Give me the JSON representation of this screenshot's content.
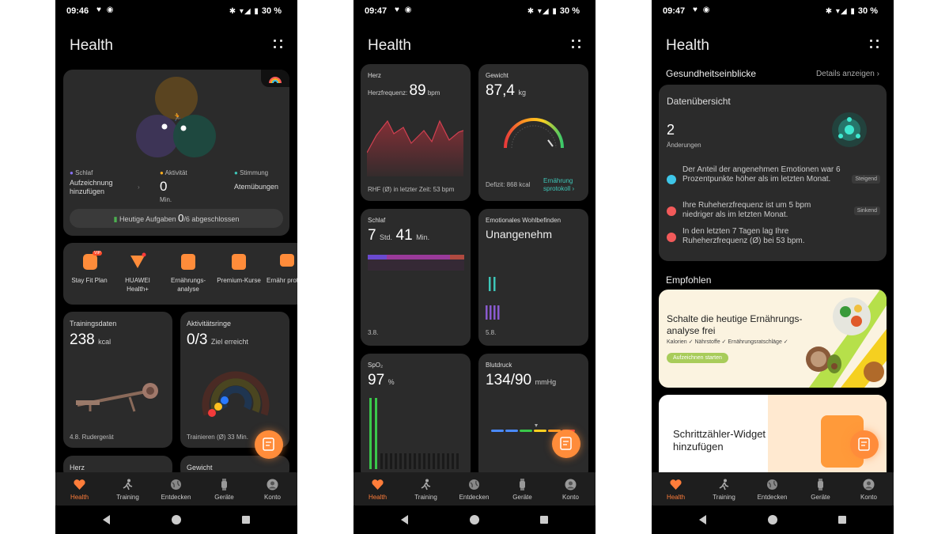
{
  "status": [
    {
      "time": "09:46",
      "icons": "♥ ◉",
      "right_icons": "✱ ▾◢ ▮",
      "battery": "30 %"
    },
    {
      "time": "09:47",
      "icons": "♥ ◉",
      "right_icons": "✱ ▾◢ ▮",
      "battery": "30 %"
    },
    {
      "time": "09:47",
      "icons": "♥ ◉",
      "right_icons": "✱ ▾◢ ▮",
      "battery": "30 %"
    }
  ],
  "app_title": "Health",
  "tabs": [
    "Health",
    "Training",
    "Entdecken",
    "Geräte",
    "Konto"
  ],
  "screen1": {
    "rings": {
      "schlaf_label": "Schlaf",
      "schlaf_value": "Aufzeichnung hinzufügen",
      "aktivitaet_label": "Aktivität",
      "aktivitaet_value": "0",
      "aktivitaet_unit": "Min.",
      "stimmung_label": "Stimmung",
      "stimmung_value": "Atemübungen",
      "tasks_prefix": "Heutige Aufgaben ",
      "tasks_count": "0",
      "tasks_suffix": "/6 abgeschlossen"
    },
    "shortcuts": [
      {
        "label": "Stay Fit Plan",
        "badge": "VIP"
      },
      {
        "label": "HUAWEI Health+"
      },
      {
        "label": "Ernährungs-analyse"
      },
      {
        "label": "Premium-Kurse"
      },
      {
        "label": "Ernähr protc"
      }
    ],
    "training": {
      "title": "Trainingsdaten",
      "value": "238",
      "unit": "kcal",
      "footer": "4.8. Rudergerät"
    },
    "rings_card": {
      "title": "Aktivitätsringe",
      "value": "0/3",
      "subtitle": "Ziel erreicht",
      "footer": "Trainieren (Ø) 33 Min."
    },
    "peek_left": "Herz",
    "peek_right": "Gewicht"
  },
  "screen2": {
    "herz": {
      "title": "Herz",
      "prefix": "Herzfrequenz:",
      "value": "89",
      "unit": "bpm",
      "footer": "RHF (Ø) in letzter Zeit: 53 bpm"
    },
    "gewicht": {
      "title": "Gewicht",
      "value": "87,4",
      "unit": "kg",
      "deficit": "Defizit: 868 kcal",
      "link1": "Ernährung",
      "link2": "sprotokoll"
    },
    "schlaf": {
      "title": "Schlaf",
      "hours": "7",
      "hours_unit": "Std.",
      "minutes": "41",
      "minutes_unit": "Min.",
      "footer": "3.8."
    },
    "emotion": {
      "title": "Emotionales Wohlbefinden",
      "value": "Unangenehm",
      "footer": "5.8."
    },
    "spo2": {
      "title": "SpO₂",
      "value": "97",
      "unit": "%"
    },
    "blutdruck": {
      "title": "Blutdruck",
      "value": "134/90",
      "unit": "mmHg"
    }
  },
  "screen3": {
    "insights_title": "Gesundheitseinblicke",
    "details_link": "Details anzeigen",
    "overview_title": "Datenübersicht",
    "changes_count": "2",
    "changes_label": "Änderungen",
    "items": [
      {
        "text": "Der Anteil der angenehmen Emotionen war 6 Prozentpunkte höher als im letzten Monat.",
        "badge": "Steigend",
        "color": "#3ec6e8"
      },
      {
        "text": "Ihre Ruheherzfrequenz ist um 5 bpm niedriger als im letzten Monat.",
        "badge": "Sinkend",
        "color": "#f25a5a"
      },
      {
        "text": "In den letzten 7 Tagen lag Ihre Ruheherzfrequenz (Ø) bei 53 bpm.",
        "badge": "",
        "color": "#f25a5a"
      }
    ],
    "recommended": "Empfohlen",
    "promo_title": "Schalte die heutige Ernährungs-analyse frei",
    "promo_tags": "Kalorien ✓ Nährstoffe ✓ Ernährungsratschläge ✓",
    "promo_button": "Aufzeichnen starten",
    "widget_title": "Schrittzähler-Widget hinzufügen"
  },
  "colors": {
    "accent": "#ff7d3a",
    "card": "#2b2b2b",
    "sleep": "#7d5cff",
    "activity": "#ffb020",
    "mood": "#3ec6b8"
  }
}
